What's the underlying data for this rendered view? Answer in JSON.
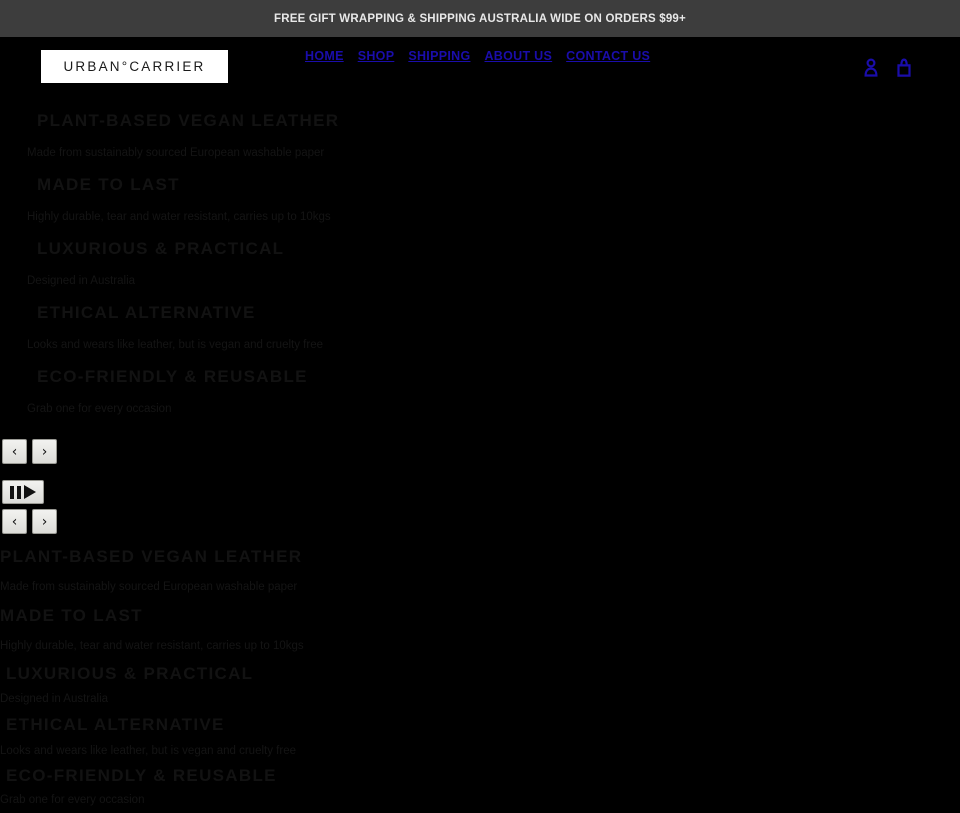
{
  "announcement": {
    "text": "FREE GIFT WRAPPING & SHIPPING AUSTRALIA WIDE ON ORDERS $99+",
    "background_color": "#3d3d3d",
    "text_color": "#e8e8e8"
  },
  "header": {
    "logo_text": "URBAN°CARRIER",
    "logo_background": "#ffffff",
    "nav": [
      {
        "label": "HOME"
      },
      {
        "label": "SHOP"
      },
      {
        "label": "SHIPPING"
      },
      {
        "label": "ABOUT US"
      },
      {
        "label": "CONTACT US"
      }
    ],
    "nav_link_color": "#1a0dab",
    "icons": [
      {
        "name": "account-icon",
        "label": "Account"
      },
      {
        "name": "cart-icon",
        "label": "Cart"
      }
    ],
    "icon_color": "#1a0dab"
  },
  "features": [
    {
      "heading": "PLANT-BASED VEGAN LEATHER",
      "body": "Made from sustainably sourced European washable paper"
    },
    {
      "heading": "MADE TO LAST",
      "body": "Highly durable, tear and water resistant, carries up to 10kgs"
    },
    {
      "heading": "LUXURIOUS & PRACTICAL",
      "body": "Designed in Australia"
    },
    {
      "heading": "ETHICAL ALTERNATIVE",
      "body": "Looks and wears like leather, but is vegan and cruelty free"
    },
    {
      "heading": "ECO-FRIENDLY & REUSABLE",
      "body": "Grab one for every occasion"
    }
  ],
  "carousel_controls": {
    "previous_label": "‹",
    "next_label": "›",
    "pause_label": "Pause",
    "play_label": "Play"
  },
  "page": {
    "background_color": "#000000",
    "text_color": "#141414"
  }
}
